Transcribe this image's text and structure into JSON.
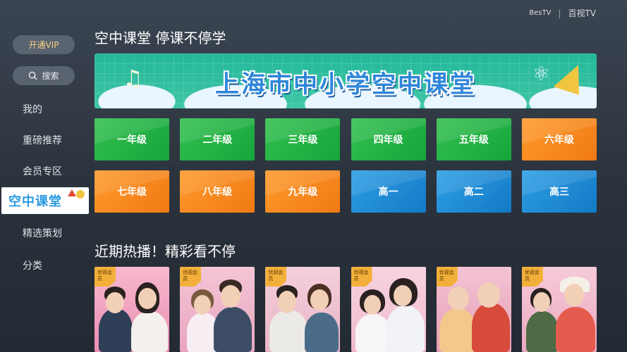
{
  "brand": {
    "bestv": "BesTV",
    "baishitong": "百视TV"
  },
  "sidebar": {
    "vip_button": "开通VIP",
    "search_button": "搜索",
    "items": [
      "我的",
      "重磅推荐",
      "会员专区",
      "精选策划",
      "分类"
    ],
    "active_item": "空中课堂"
  },
  "main": {
    "section1_title": "空中课堂 停课不停学",
    "banner_title": "上海市中小学空中课堂",
    "grades": [
      {
        "label": "一年级",
        "color": "green"
      },
      {
        "label": "二年级",
        "color": "green"
      },
      {
        "label": "三年级",
        "color": "green"
      },
      {
        "label": "四年级",
        "color": "green"
      },
      {
        "label": "五年级",
        "color": "green"
      },
      {
        "label": "六年级",
        "color": "orange"
      },
      {
        "label": "七年级",
        "color": "orange"
      },
      {
        "label": "八年级",
        "color": "orange"
      },
      {
        "label": "九年级",
        "color": "orange"
      },
      {
        "label": "高一",
        "color": "blue"
      },
      {
        "label": "高二",
        "color": "blue"
      },
      {
        "label": "高三",
        "color": "blue"
      }
    ],
    "section2_title": "近期热播！精彩看不停",
    "poster_badge": "优视会员"
  },
  "colors": {
    "green": "#22b044",
    "orange": "#f5871e",
    "blue": "#1f8cd6",
    "vip_text": "#f6cf86"
  }
}
